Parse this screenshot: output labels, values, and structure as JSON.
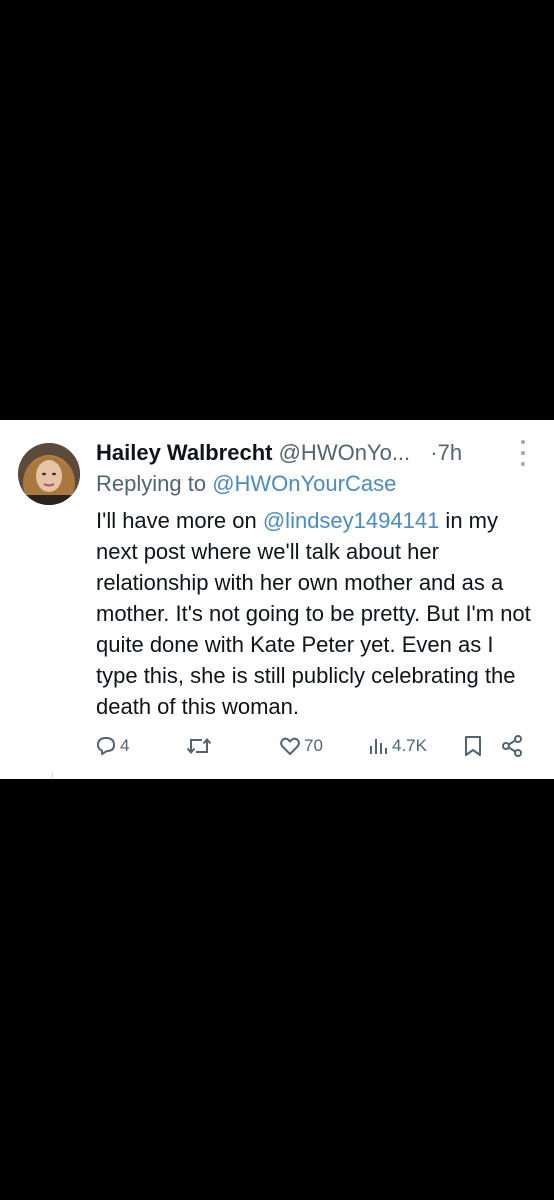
{
  "tweet": {
    "author_name": "Hailey Walbrecht",
    "author_handle": "@HWOnYo...",
    "separator": "·",
    "time": "7h",
    "reply_prefix": "Replying to ",
    "reply_to": "@HWOnYourCase",
    "body": {
      "part1": "I'll have more on ",
      "mention": "@lindsey1494141",
      "part2": " in my next post where we'll talk about her relationship with her own mother and as a mother. It's not going to be pretty. But I'm not quite done with Kate Peter yet. Even as I type this, she is still publicly celebrating the death of this woman."
    },
    "actions": {
      "replies": "4",
      "retweets": "",
      "likes": "70",
      "views": "4.7K"
    }
  },
  "colors": {
    "background": "#000000",
    "card": "#ffffff",
    "text": "#0f1419",
    "secondary": "#536471",
    "link": "#4a8bc4"
  },
  "icons": [
    "avatar-photo",
    "more-vertical-icon",
    "reply-icon",
    "retweet-icon",
    "like-icon",
    "views-icon",
    "bookmark-icon",
    "share-icon"
  ]
}
